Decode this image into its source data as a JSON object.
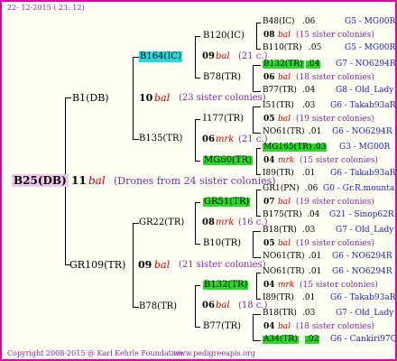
{
  "header": {
    "date": "22- 12-2015 ( 23: 12)"
  },
  "footer": {
    "copyright": "Copyright 2008-2015 @ Karl Kehrle Foundation.",
    "site": "www.pedigreeapis.org"
  },
  "colors": {
    "border": "#e000a0",
    "highlight_green": "#22dd22",
    "highlight_cyan": "#22dddd",
    "root_bg": "#f2c8f2",
    "mating_red": "#d00000",
    "blue_text": "#1a1acc",
    "purple_text": "#7a2aa8"
  },
  "root": {
    "id": "B25(DB)",
    "gen_num": "11",
    "mating": "bal",
    "note": "(Drones from 24 sister colonies)"
  },
  "gen1": [
    {
      "id": "B1(DB)",
      "gen_num": "10",
      "mating": "bal",
      "note": "(23 sister colonies)"
    },
    {
      "id": "GR109(TR)",
      "gen_num": "09",
      "mating": "bal",
      "note": "(21 sister colonies)"
    }
  ],
  "gen2": [
    {
      "id": "B164(IC)",
      "gen_num": "09",
      "mating": "bal",
      "note": "(21 c.)"
    },
    {
      "id": "B135(TR)",
      "gen_num": "06",
      "mating": "mrk",
      "note": "(21 c.)"
    },
    {
      "id": "GR22(TR)",
      "gen_num": "08",
      "mating": "mrk",
      "note": "(16 c.)"
    },
    {
      "id": "B78(TR)",
      "gen_num": "06",
      "mating": "bal",
      "note": "(18 c.)"
    }
  ],
  "gen3": [
    "B120(IC)",
    "B78(TR)",
    "I177(TR)",
    "MG60(TR)",
    "GR51(TR)",
    "B10(TR)",
    "B132(TR)",
    "B77(TR)"
  ],
  "gen4": [
    {
      "id": "B48(IC)",
      "num": ".06",
      "code": "G5 - MG00R"
    },
    {
      "gn": "08",
      "mating": "bal",
      "note": "(15 sister colonies)"
    },
    {
      "id": "B110(TR)",
      "num": ".05",
      "code": "G5 - MG00R"
    },
    {
      "id": "B132(TR)",
      "num": ".04",
      "code": "G7 - NO6294R"
    },
    {
      "gn": "06",
      "mating": "bal",
      "note": "(18 sister colonies)"
    },
    {
      "id": "B77(TR)",
      "num": ".04",
      "code": "G8 - Old_Lady"
    },
    {
      "id": "I51(TR)",
      "num": ".03",
      "code": "G6 - Takab93aR"
    },
    {
      "gn": "05",
      "mating": "bal",
      "note": "(19 sister colonies)"
    },
    {
      "id": "NO61(TR)",
      "num": ".01",
      "code": "G6 - NO6294R"
    },
    {
      "id": "MG165(TR)",
      "num": ".03",
      "code": "G3 - MG00R"
    },
    {
      "gn": "04",
      "mating": "mrk",
      "note": "(15 sister colonies)"
    },
    {
      "id": "I89(TR)",
      "num": ".01",
      "code": "G6 - Takab93aR"
    },
    {
      "id": "GR1(PN)",
      "num": ".06",
      "code": "G0 - Gr.R.mounta"
    },
    {
      "gn": "07",
      "mating": "bal",
      "note": "(19 sister colonies)"
    },
    {
      "id": "B175(TR)",
      "num": ".04",
      "code": "G21 - Sinop62R"
    },
    {
      "id": "B18(TR)",
      "num": ".03",
      "code": "G7 - Old_Lady"
    },
    {
      "gn": "05",
      "mating": "bal",
      "note": "(19 sister colonies)"
    },
    {
      "id": "NO61(TR)",
      "num": ".01",
      "code": "G6 - NO6294R"
    },
    {
      "id": "NO61(TR)",
      "num": ".01",
      "code": "G6 - NO6294R"
    },
    {
      "gn": "04",
      "mating": "mrk",
      "note": "(15 sister colonies)"
    },
    {
      "id": "I89(TR)",
      "num": ".01",
      "code": "G6 - Takab93aR"
    },
    {
      "id": "B18(TR)",
      "num": ".03",
      "code": "G7 - Old_Lady"
    },
    {
      "gn": "04",
      "mating": "bal",
      "note": "(18 sister colonies)"
    },
    {
      "id": "A34(TR)",
      "num": ".02",
      "code": "G6 - Cankiri97Q"
    }
  ]
}
